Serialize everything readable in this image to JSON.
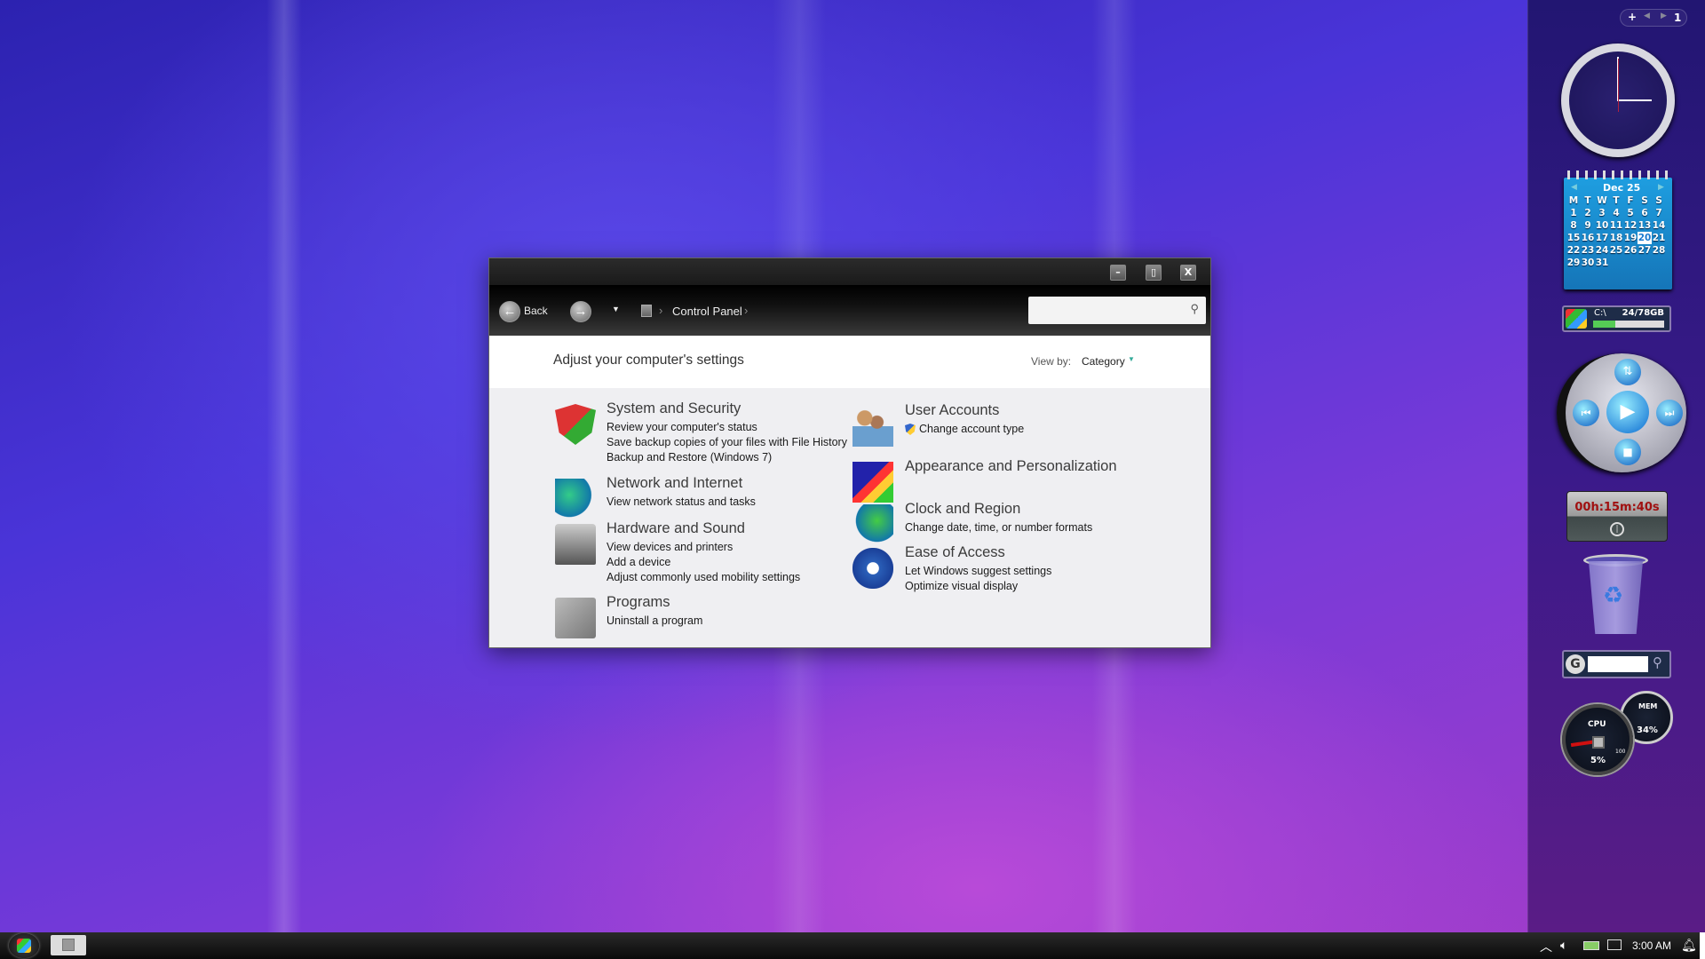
{
  "window": {
    "nav": {
      "back_label": "Back",
      "breadcrumb": "Control Panel",
      "search_placeholder": ""
    },
    "header": {
      "title": "Adjust your computer's settings",
      "view_by_label": "View by:",
      "view_by_value": "Category"
    },
    "categories_left": [
      {
        "title": "System and Security",
        "icon": "shield-icon",
        "links": [
          "Review your computer's status",
          "Save backup copies of your files with File History",
          "Backup and Restore (Windows 7)"
        ]
      },
      {
        "title": "Network and Internet",
        "icon": "network-globe-icon",
        "links": [
          "View network status and tasks"
        ]
      },
      {
        "title": "Hardware and Sound",
        "icon": "printer-icon",
        "links": [
          "View devices and printers",
          "Add a device",
          "Adjust commonly used mobility settings"
        ]
      },
      {
        "title": "Programs",
        "icon": "programs-box-icon",
        "links": [
          "Uninstall a program"
        ]
      }
    ],
    "categories_right": [
      {
        "title": "User Accounts",
        "icon": "users-icon",
        "links": [
          "Change account type"
        ]
      },
      {
        "title": "Appearance and Personalization",
        "icon": "monitor-palette-icon",
        "links": []
      },
      {
        "title": "Clock and Region",
        "icon": "globe-clock-icon",
        "links": [
          "Change date, time, or number formats"
        ]
      },
      {
        "title": "Ease of Access",
        "icon": "ease-of-access-icon",
        "links": [
          "Let Windows suggest settings",
          "Optimize visual display"
        ]
      }
    ]
  },
  "gadgets": {
    "toolbar": {
      "add": "+",
      "page": "1"
    },
    "calendar": {
      "month": "Dec 25",
      "days": [
        "M",
        "T",
        "W",
        "T",
        "F",
        "S",
        "S"
      ],
      "weeks": [
        [
          "1",
          "2",
          "3",
          "4",
          "5",
          "6",
          "7"
        ],
        [
          "8",
          "9",
          "10",
          "11",
          "12",
          "13",
          "14"
        ],
        [
          "15",
          "16",
          "17",
          "18",
          "19",
          "20",
          "21"
        ],
        [
          "22",
          "23",
          "24",
          "25",
          "26",
          "27",
          "28"
        ],
        [
          "29",
          "30",
          "31",
          "",
          "",
          "",
          ""
        ]
      ],
      "today": "20"
    },
    "drive": {
      "label": "C:\\",
      "usage": "24/78GB",
      "fraction": 0.31
    },
    "timer": {
      "value": "00h:15m:40s"
    },
    "cpu": {
      "label": "CPU",
      "value": "5%",
      "max": "100"
    },
    "mem": {
      "label": "MEM",
      "value": "34%"
    }
  },
  "taskbar": {
    "time": "3:00 AM"
  },
  "colors": {
    "accent": "#1a8fd0",
    "timer_text": "#a01010"
  }
}
